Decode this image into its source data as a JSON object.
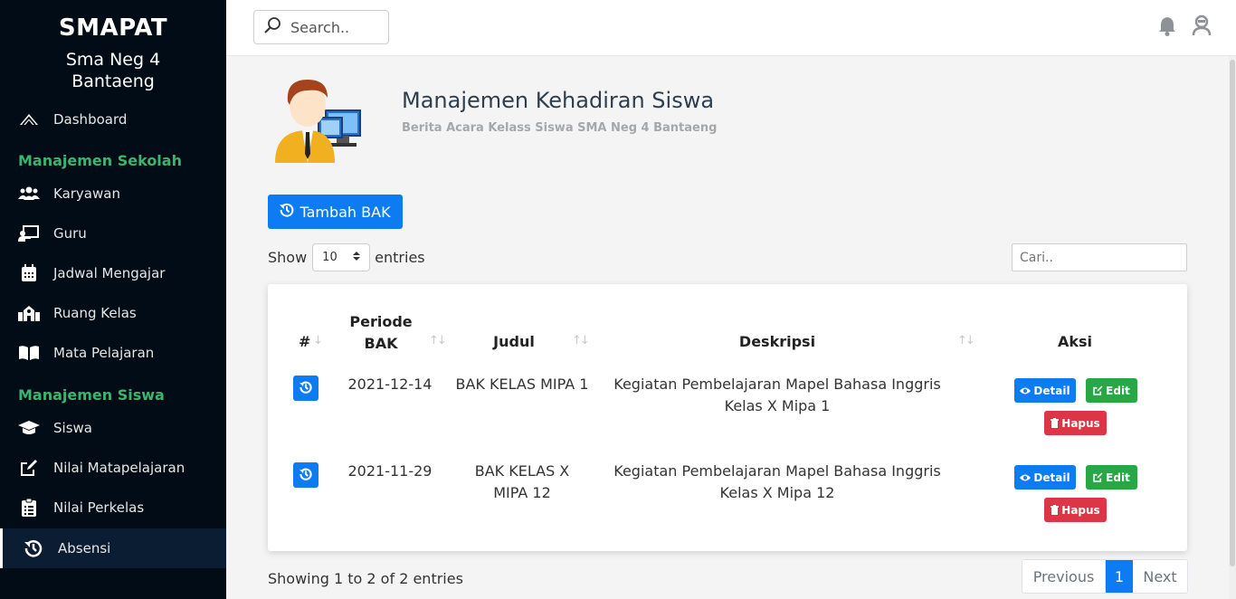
{
  "brand": {
    "title": "SMAPAT",
    "subtitle": "Sma Neg 4 Bantaeng"
  },
  "sidebar": {
    "dashboard": "Dashboard",
    "section_sekolah": "Manajemen Sekolah",
    "section_siswa": "Manajemen Siswa",
    "items": [
      {
        "label": "Karyawan",
        "icon": "users-icon"
      },
      {
        "label": "Guru",
        "icon": "chalkboard-teacher-icon"
      },
      {
        "label": "Jadwal Mengajar",
        "icon": "calendar-icon"
      },
      {
        "label": "Ruang Kelas",
        "icon": "school-icon"
      },
      {
        "label": "Mata Pelajaran",
        "icon": "book-open-icon"
      },
      {
        "label": "Siswa",
        "icon": "graduation-cap-icon"
      },
      {
        "label": "Nilai Matapelajaran",
        "icon": "edit-icon"
      },
      {
        "label": "Nilai Perkelas",
        "icon": "clipboard-list-icon"
      },
      {
        "label": "Absensi",
        "icon": "history-icon",
        "active": true
      }
    ]
  },
  "topbar": {
    "search_placeholder": "Search.."
  },
  "header": {
    "title": "Manajemen Kehadiran Siswa",
    "subtitle": "Berita Acara Kelass Siswa SMA Neg 4 Bantaeng"
  },
  "toolbar": {
    "add_label": "Tambah BAK",
    "show_label": "Show",
    "entries_value": "10",
    "entries_label": "entries",
    "search_placeholder": "Cari.."
  },
  "table": {
    "headers": {
      "no": "#",
      "periode_1": "Periode",
      "periode_2": "BAK",
      "judul": "Judul",
      "deskripsi": "Deskripsi",
      "aksi": "Aksi"
    },
    "rows": [
      {
        "periode": "2021-12-14",
        "judul_1": "BAK KELAS MIPA 1",
        "judul_2": "",
        "deskripsi_1": "Kegiatan Pembelajaran Mapel Bahasa Inggris",
        "deskripsi_2": "Kelas X Mipa 1"
      },
      {
        "periode": "2021-11-29",
        "judul_1": "BAK KELAS X",
        "judul_2": "MIPA 12",
        "deskripsi_1": "Kegiatan Pembelajaran Mapel Bahasa Inggris",
        "deskripsi_2": "Kelas X Mipa 12"
      }
    ],
    "actions": {
      "detail": "Detail",
      "edit": "Edit",
      "hapus": "Hapus"
    }
  },
  "footer": {
    "showing": "Showing 1 to 2 of 2 entries",
    "prev": "Previous",
    "page": "1",
    "next": "Next"
  },
  "colors": {
    "primary": "#0d7cf2",
    "success": "#28a745",
    "danger": "#dc3545",
    "sidebar": "#020c16",
    "section": "#3bb56e"
  }
}
